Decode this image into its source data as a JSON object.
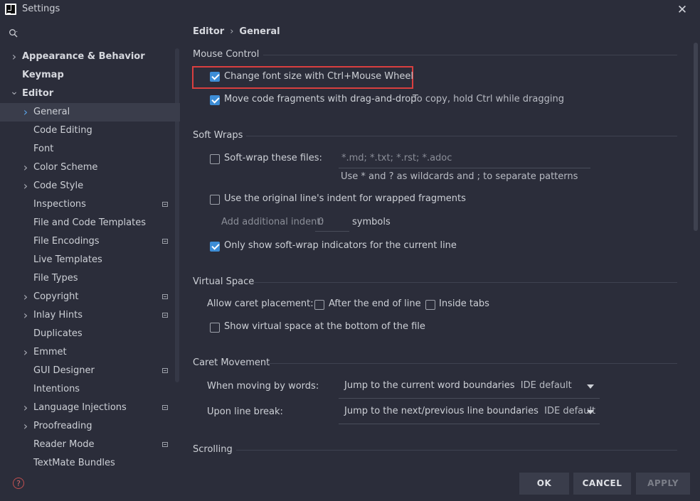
{
  "window": {
    "title": "Settings"
  },
  "breadcrumb": [
    "Editor",
    "General"
  ],
  "sidebar": {
    "items": [
      {
        "label": "Appearance & Behavior",
        "level": 0,
        "chevron": "right",
        "bold": true
      },
      {
        "label": "Keymap",
        "level": 0,
        "chevron": "",
        "bold": true
      },
      {
        "label": "Editor",
        "level": 0,
        "chevron": "down",
        "bold": true
      },
      {
        "label": "General",
        "level": 1,
        "chevron": "right",
        "selected": true
      },
      {
        "label": "Code Editing",
        "level": 1,
        "chevron": ""
      },
      {
        "label": "Font",
        "level": 1,
        "chevron": ""
      },
      {
        "label": "Color Scheme",
        "level": 1,
        "chevron": "right"
      },
      {
        "label": "Code Style",
        "level": 1,
        "chevron": "right"
      },
      {
        "label": "Inspections",
        "level": 1,
        "chevron": "",
        "project_icon": true
      },
      {
        "label": "File and Code Templates",
        "level": 1,
        "chevron": ""
      },
      {
        "label": "File Encodings",
        "level": 1,
        "chevron": "",
        "project_icon": true
      },
      {
        "label": "Live Templates",
        "level": 1,
        "chevron": ""
      },
      {
        "label": "File Types",
        "level": 1,
        "chevron": ""
      },
      {
        "label": "Copyright",
        "level": 1,
        "chevron": "right",
        "project_icon": true
      },
      {
        "label": "Inlay Hints",
        "level": 1,
        "chevron": "right",
        "project_icon": true
      },
      {
        "label": "Duplicates",
        "level": 1,
        "chevron": ""
      },
      {
        "label": "Emmet",
        "level": 1,
        "chevron": "right"
      },
      {
        "label": "GUI Designer",
        "level": 1,
        "chevron": "",
        "project_icon": true
      },
      {
        "label": "Intentions",
        "level": 1,
        "chevron": ""
      },
      {
        "label": "Language Injections",
        "level": 1,
        "chevron": "right",
        "project_icon": true
      },
      {
        "label": "Proofreading",
        "level": 1,
        "chevron": "right"
      },
      {
        "label": "Reader Mode",
        "level": 1,
        "chevron": "",
        "project_icon": true
      },
      {
        "label": "TextMate Bundles",
        "level": 1,
        "chevron": ""
      }
    ]
  },
  "mouse_control": {
    "title": "Mouse Control",
    "font_size_label": "Change font size with Ctrl+Mouse Wheel",
    "font_size_checked": true,
    "drag_drop_label": "Move code fragments with drag-and-drop",
    "drag_drop_checked": true,
    "drag_drop_hint": "To copy, hold Ctrl while dragging"
  },
  "soft_wraps": {
    "title": "Soft Wraps",
    "softwrap_label": "Soft-wrap these files:",
    "softwrap_checked": false,
    "softwrap_placeholder": "*.md; *.txt; *.rst; *.adoc",
    "softwrap_hint": "Use * and ? as wildcards and ; to separate patterns",
    "indent_label": "Use the original line's indent for wrapped fragments",
    "indent_checked": false,
    "additional_indent_label": "Add additional indent:",
    "additional_indent_value": "0",
    "additional_indent_unit": "symbols",
    "indicators_label": "Only show soft-wrap indicators for the current line",
    "indicators_checked": true
  },
  "virtual_space": {
    "title": "Virtual Space",
    "caret_label": "Allow caret placement:",
    "after_end_label": "After the end of line",
    "after_end_checked": false,
    "inside_tabs_label": "Inside tabs",
    "inside_tabs_checked": false,
    "bottom_label": "Show virtual space at the bottom of the file",
    "bottom_checked": false
  },
  "caret_movement": {
    "title": "Caret Movement",
    "words_label": "When moving by words:",
    "words_value": "Jump to the current word boundaries",
    "words_suffix": "IDE default",
    "linebreak_label": "Upon line break:",
    "linebreak_value": "Jump to the next/previous line boundaries",
    "linebreak_suffix": "IDE default"
  },
  "scrolling": {
    "title": "Scrolling"
  },
  "buttons": {
    "ok": "OK",
    "cancel": "CANCEL",
    "apply": "APPLY"
  },
  "icons": {
    "help": "?",
    "close": "✕"
  },
  "colors": {
    "accent": "#3d8dd6",
    "highlight": "#d93f3f",
    "background": "#2b2d3a"
  }
}
